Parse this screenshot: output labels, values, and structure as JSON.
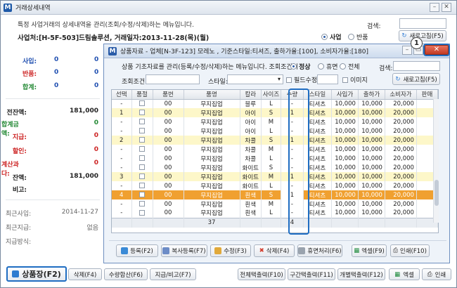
{
  "outer": {
    "title": "거래상세내역",
    "description": "특정 사업거래의 상세내역을 관리(조회/수정/삭제)하는 메뉴입니다.",
    "search_label": "검색:",
    "account_line": "사업처:[H-5F-503]드림솔루션, 거래일자:2013-11-28(목)(월)",
    "radio_business": "사업",
    "radio_return": "반품",
    "refresh": "새로고침(F5)"
  },
  "left": {
    "rows": [
      {
        "label": "사입:",
        "a": "0",
        "b": "0",
        "color": "#1f4fb0"
      },
      {
        "label": "반품:",
        "a": "0",
        "b": "0",
        "color": "#cc2222"
      },
      {
        "label": "합계:",
        "a": "0",
        "b": "0",
        "color": "#228833"
      }
    ],
    "totals": [
      {
        "label": "전잔액:",
        "v": "181,000",
        "color": "#222"
      },
      {
        "label": "합계금액:",
        "v": "0",
        "color": "#228833"
      },
      {
        "label": "지급:",
        "v": "0",
        "color": "#cc2222"
      },
      {
        "label": "할인:",
        "v": "0",
        "color": "#cc2222"
      },
      {
        "label": "계산과다:",
        "v": "0",
        "color": "#cc2222"
      },
      {
        "label": "잔액:",
        "v": "181,000",
        "color": "#222"
      },
      {
        "label": "비고:",
        "v": "",
        "color": "#222"
      }
    ],
    "recent": [
      {
        "label": "최근사입:",
        "v": "2014-11-27"
      },
      {
        "label": "최근지급:",
        "v": "없음"
      },
      {
        "label": "지급방식:",
        "v": ""
      }
    ]
  },
  "dialog": {
    "title": "상품자료 - 업체[N-3F-123] 모레노 , 기준스타일:티셔즈, 출하가율:[100], 소비자가율:[180]",
    "description": "상품 기초자료를 관리(등록/수정/삭제)하는 메뉴입니다. 조회조건이",
    "radio_normal": "정상",
    "radio_rest": "휴면",
    "radio_all": "전체",
    "search_label": "검색:",
    "cond_label": "조회조건:",
    "style_label": "스타일:",
    "required_edit": "필드수정",
    "image": "이미지",
    "refresh": "새로고침(F5)",
    "columns": [
      "선택",
      "품절",
      "품번",
      "품명",
      "칼라",
      "사이즈",
      "수량",
      "스타일",
      "사입가",
      "출하가",
      "소비자가",
      "판매"
    ],
    "rows": [
      {
        "t": "w",
        "sel": "-",
        "no": "00",
        "name": "무지집업",
        "color": "블루",
        "size": "L",
        "qty": "-",
        "style": "티셔츠",
        "buy": "10,000",
        "ship": "10,000",
        "retail": "20,000"
      },
      {
        "t": "y",
        "sel": "1",
        "no": "00",
        "name": "무지집업",
        "color": "아이",
        "size": "S",
        "qty": "1",
        "style": "티셔츠",
        "buy": "10,000",
        "ship": "10,000",
        "retail": "20,000"
      },
      {
        "t": "w",
        "sel": "-",
        "no": "00",
        "name": "무지집업",
        "color": "아이",
        "size": "M",
        "qty": "-",
        "style": "티셔츠",
        "buy": "10,000",
        "ship": "10,000",
        "retail": "20,000"
      },
      {
        "t": "w",
        "sel": "-",
        "no": "00",
        "name": "무지집업",
        "color": "아이",
        "size": "L",
        "qty": "-",
        "style": "티셔츠",
        "buy": "10,000",
        "ship": "10,000",
        "retail": "20,000"
      },
      {
        "t": "y",
        "sel": "2",
        "no": "00",
        "name": "무지집업",
        "color": "차콜",
        "size": "S",
        "qty": "1",
        "style": "티셔츠",
        "buy": "10,000",
        "ship": "10,000",
        "retail": "20,000"
      },
      {
        "t": "w",
        "sel": "-",
        "no": "00",
        "name": "무지집업",
        "color": "차콜",
        "size": "M",
        "qty": "-",
        "style": "티셔츠",
        "buy": "10,000",
        "ship": "10,000",
        "retail": "20,000"
      },
      {
        "t": "w",
        "sel": "-",
        "no": "00",
        "name": "무지집업",
        "color": "차콜",
        "size": "L",
        "qty": "-",
        "style": "티셔츠",
        "buy": "10,000",
        "ship": "10,000",
        "retail": "20,000"
      },
      {
        "t": "w",
        "sel": "-",
        "no": "00",
        "name": "무지집업",
        "color": "화이트",
        "size": "S",
        "qty": "-",
        "style": "티셔츠",
        "buy": "10,000",
        "ship": "10,000",
        "retail": "20,000"
      },
      {
        "t": "y",
        "sel": "3",
        "no": "00",
        "name": "무지집업",
        "color": "화이트",
        "size": "M",
        "qty": "1",
        "style": "티셔츠",
        "buy": "10,000",
        "ship": "10,000",
        "retail": "20,000"
      },
      {
        "t": "w",
        "sel": "-",
        "no": "00",
        "name": "무지집업",
        "color": "화이트",
        "size": "L",
        "qty": "-",
        "style": "티셔츠",
        "buy": "10,000",
        "ship": "10,000",
        "retail": "20,000"
      },
      {
        "t": "o",
        "sel": "4",
        "no": "00",
        "name": "무지집업",
        "color": "흰색",
        "size": "S",
        "qty": "1",
        "style": "티셔츠",
        "buy": "10,000",
        "ship": "10,000",
        "retail": "20,000"
      },
      {
        "t": "w",
        "sel": "-",
        "no": "00",
        "name": "무지집업",
        "color": "흰색",
        "size": "M",
        "qty": "-",
        "style": "티셔츠",
        "buy": "10,000",
        "ship": "10,000",
        "retail": "20,000"
      },
      {
        "t": "w",
        "sel": "-",
        "no": "00",
        "name": "무지집업",
        "color": "흰색",
        "size": "L",
        "qty": "-",
        "style": "티셔츠",
        "buy": "10,000",
        "ship": "10,000",
        "retail": "20,000"
      }
    ],
    "footer_count": "37",
    "footer_qty": "4",
    "buttons": [
      "등록(F2)",
      "복사등록(F7)",
      "수정(F3)",
      "삭제(F4)",
      "휴면처리(F6)",
      "엑셀(F9)",
      "인쇄(F10)"
    ],
    "badge": "1"
  },
  "bottom": {
    "product_btn": "상품장(F2)",
    "buttons": [
      "삭제(F4)",
      "수량합산(F6)",
      "지급/비고(F7)",
      "전체택출력(F10)",
      "구간택출력(F11)",
      "개별택출력(F12)",
      "엑셀",
      "인쇄"
    ]
  }
}
